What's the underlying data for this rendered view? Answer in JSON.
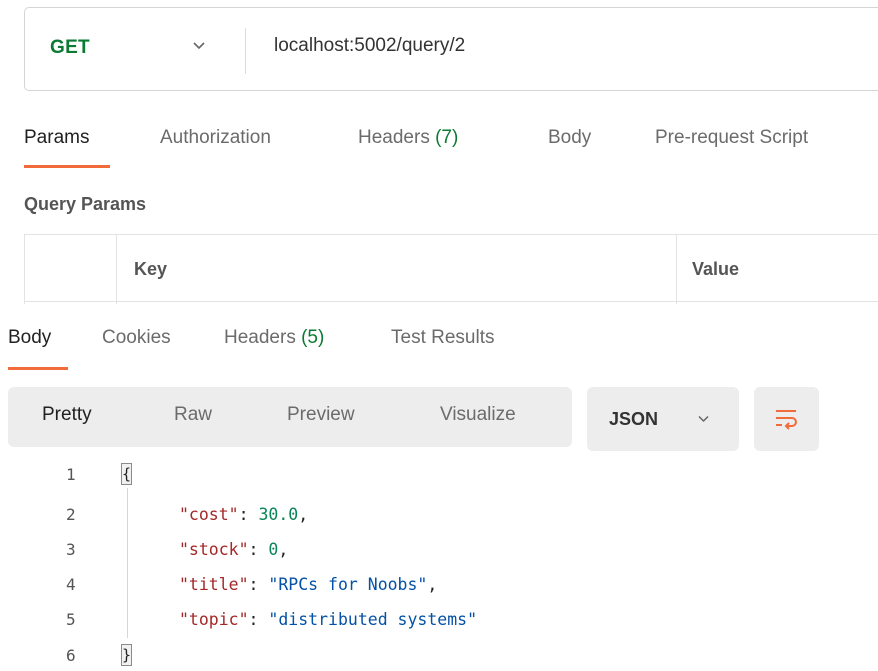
{
  "request": {
    "method": "GET",
    "url": "localhost:5002/query/2"
  },
  "request_tabs": [
    {
      "label": "Params",
      "active": true
    },
    {
      "label": "Authorization"
    },
    {
      "label": "Headers",
      "count": "(7)"
    },
    {
      "label": "Body"
    },
    {
      "label": "Pre-request Script"
    }
  ],
  "query_params": {
    "title": "Query Params",
    "columns": [
      "Key",
      "Value"
    ]
  },
  "response_tabs": [
    {
      "label": "Body",
      "active": true
    },
    {
      "label": "Cookies"
    },
    {
      "label": "Headers",
      "count": "(5)"
    },
    {
      "label": "Test Results"
    }
  ],
  "view_modes": [
    "Pretty",
    "Raw",
    "Preview",
    "Visualize"
  ],
  "active_view_mode": "Pretty",
  "format": "JSON",
  "response_body": {
    "line_numbers": [
      "1",
      "2",
      "3",
      "4",
      "5",
      "6"
    ],
    "open_brace": "{",
    "close_brace": "}",
    "lines": [
      {
        "key": "\"cost\"",
        "value": "30.0",
        "type": "number",
        "comma": ","
      },
      {
        "key": "\"stock\"",
        "value": "0",
        "type": "number",
        "comma": ","
      },
      {
        "key": "\"title\"",
        "value": "\"RPCs for Noobs\"",
        "type": "string",
        "comma": ","
      },
      {
        "key": "\"topic\"",
        "value": "\"distributed systems\"",
        "type": "string",
        "comma": ""
      }
    ]
  },
  "colors": {
    "accent": "#f26b3a",
    "method_green": "#0b7a32",
    "json_key": "#a32828",
    "json_string": "#0451a5",
    "json_number": "#098658"
  }
}
